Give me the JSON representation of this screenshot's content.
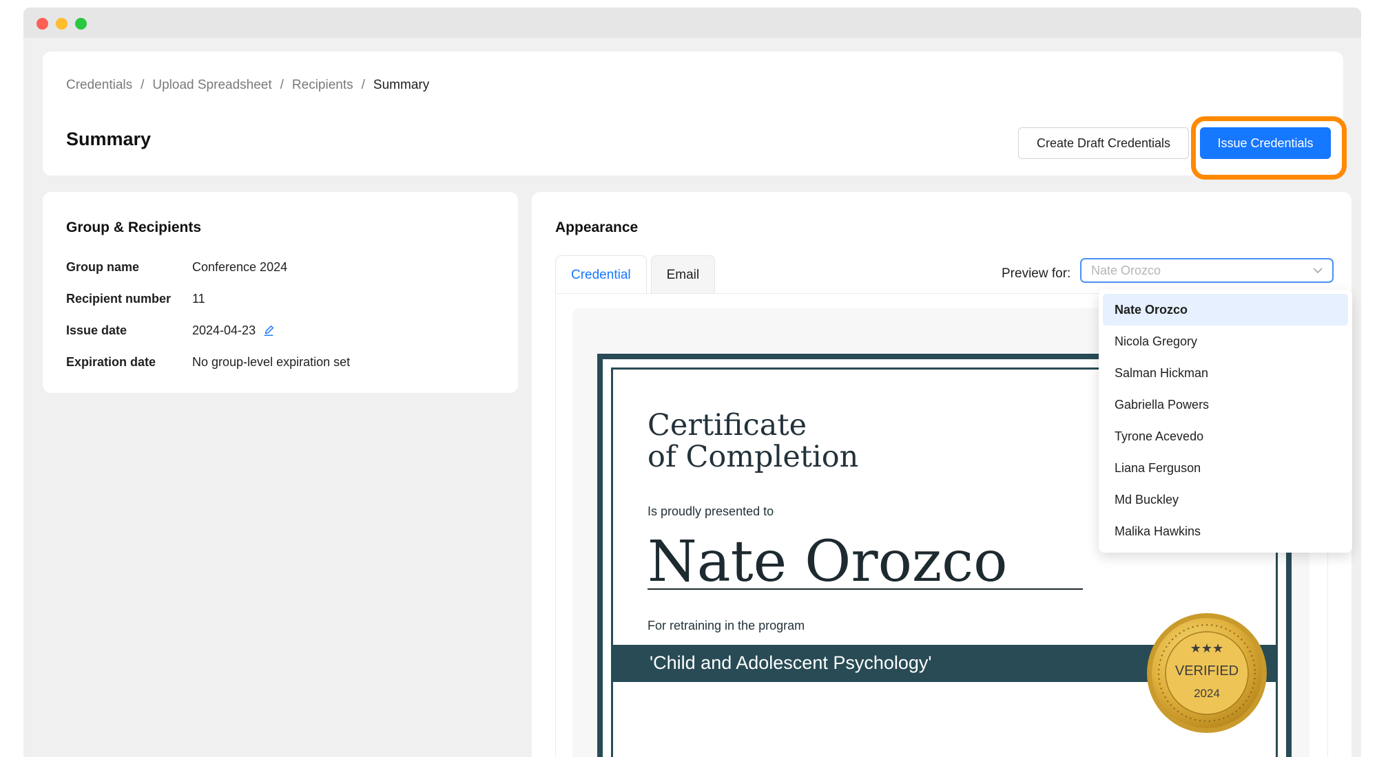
{
  "breadcrumb": {
    "items": [
      "Credentials",
      "Upload Spreadsheet",
      "Recipients"
    ],
    "current": "Summary",
    "separator": "/"
  },
  "page": {
    "title": "Summary"
  },
  "actions": {
    "draft_label": "Create Draft Credentials",
    "issue_label": "Issue Credentials",
    "highlight_color": "#ff8a00",
    "primary_color": "#1677ff"
  },
  "group": {
    "title": "Group & Recipients",
    "rows": [
      {
        "label": "Group name",
        "value": "Conference 2024"
      },
      {
        "label": "Recipient number",
        "value": "11"
      },
      {
        "label": "Issue date",
        "value": "2024-04-23",
        "icon": "edit-icon"
      },
      {
        "label": "Expiration date",
        "value": "No group-level expiration set"
      }
    ]
  },
  "appearance": {
    "title": "Appearance",
    "tabs": [
      {
        "label": "Credential",
        "active": true
      },
      {
        "label": "Email",
        "active": false
      }
    ],
    "preview_label": "Preview for:",
    "preview_selected": "Nate Orozco",
    "dropdown_options": [
      "Nate Orozco",
      "Nicola Gregory",
      "Salman Hickman",
      "Gabriella Powers",
      "Tyrone Acevedo",
      "Liana Ferguson",
      "Md Buckley",
      "Malika Hawkins"
    ]
  },
  "certificate": {
    "title_line1": "Certificate",
    "title_line2": "of Completion",
    "presented": "Is proudly presented to",
    "recipient": "Nate Orozco",
    "program_label": "For retraining in the program",
    "program": "'Child and Adolescent Psychology'",
    "seal_text": "VERIFIED",
    "seal_year": "2024",
    "border_color": "#284b55"
  }
}
